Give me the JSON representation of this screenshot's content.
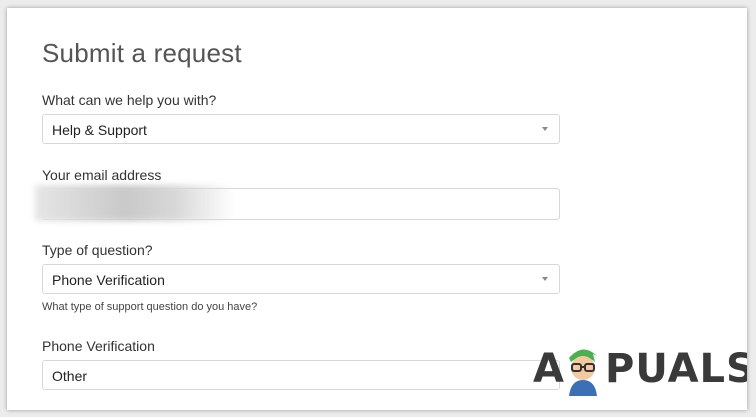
{
  "form": {
    "title": "Submit a request",
    "help_label": "What can we help you with?",
    "help_value": "Help & Support",
    "email_label": "Your email address",
    "email_value": "",
    "question_type_label": "Type of question?",
    "question_type_value": "Phone Verification",
    "question_type_hint": "What type of support question do you have?",
    "phone_verification_label": "Phone Verification",
    "phone_verification_value": "Other"
  },
  "watermark": {
    "letter_a": "A",
    "rest": "PUALS"
  },
  "colors": {
    "background": "#ececec",
    "card": "#ffffff",
    "border": "#d8d8d8",
    "title": "#555555"
  }
}
